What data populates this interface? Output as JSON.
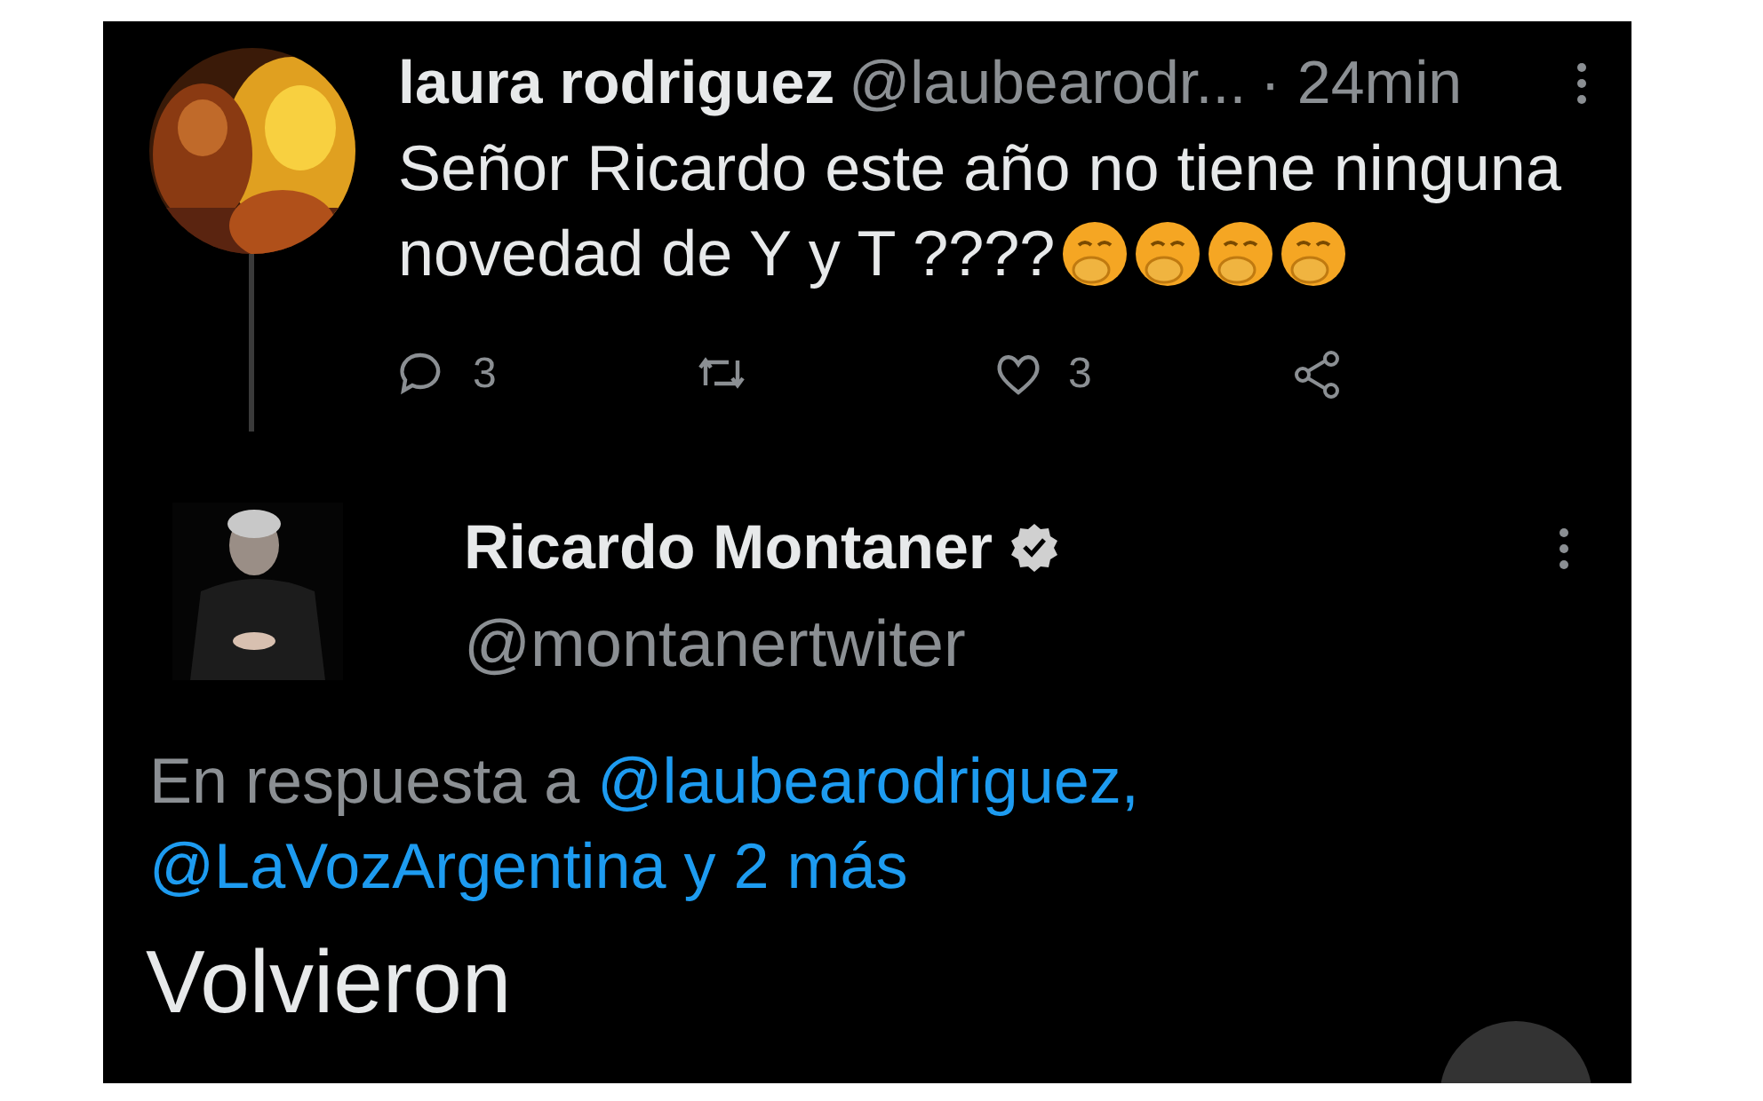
{
  "parent_tweet": {
    "author_name": "laura rodriguez",
    "handle": "@laubearodr...",
    "time": "· 24min",
    "text_lines": [
      "Señor Ricardo este año no tiene ninguna",
      "novedad de Y y T ????"
    ],
    "emojis": [
      {
        "kind": "hand-over-mouth"
      },
      {
        "kind": "hand-over-mouth"
      },
      {
        "kind": "hand-over-mouth"
      },
      {
        "kind": "hand-over-mouth"
      }
    ],
    "actions": [
      {
        "kind": "reply",
        "count": "3"
      },
      {
        "kind": "retweet"
      },
      {
        "kind": "like",
        "count": "3"
      },
      {
        "kind": "share"
      }
    ]
  },
  "main_tweet": {
    "author_name": "Ricardo Montaner",
    "verified": true,
    "handle": "@montanertwiter",
    "reply_context": {
      "prefix": "En respuesta a",
      "mentions": [
        "@laubearodriguez,",
        "@LaVozArgentina"
      ],
      "suffix": "y 2 más"
    },
    "text": "Volvieron"
  }
}
